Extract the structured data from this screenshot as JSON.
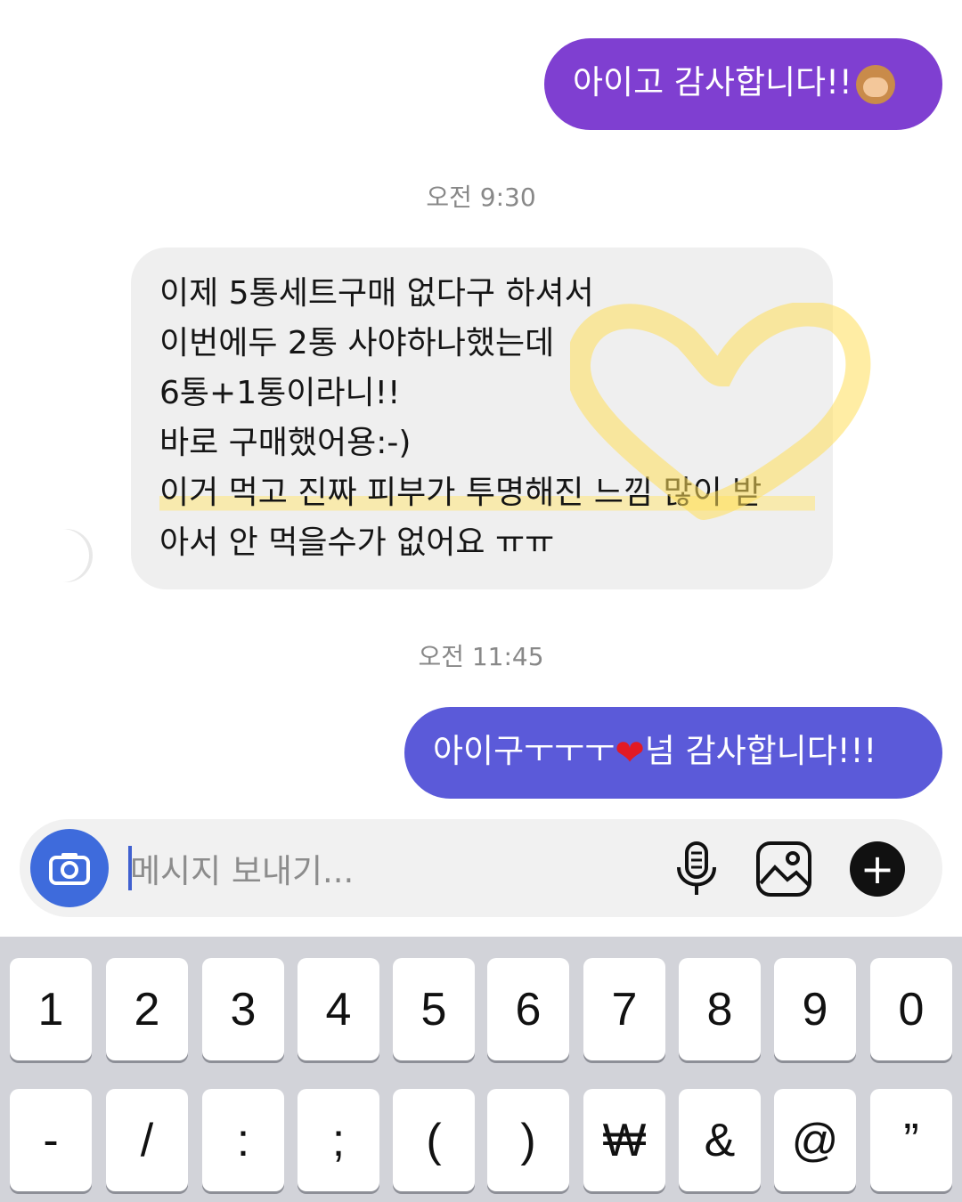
{
  "messages": [
    {
      "direction": "outgoing",
      "text": "아이고 감사합니다!!",
      "emoji": "see-no-evil-monkey"
    },
    {
      "type": "timestamp",
      "text": "오전 9:30"
    },
    {
      "direction": "incoming",
      "lines": [
        "이제 5통세트구매 없다구 하셔서",
        "이번에두 2통 사야하나했는데",
        "6통+1통이라니!!",
        "바로 구매했어용:-)",
        "이거 먹고 진짜 피부가 투명해진 느낌 많이 받",
        "아서 안 먹을수가 없어요 ㅠㅠ"
      ]
    },
    {
      "type": "timestamp",
      "text": "오전 11:45"
    },
    {
      "direction": "outgoing",
      "text_before": "아이구ㅜㅜㅜ",
      "emoji": "red-heart",
      "text_after": "넘 감사합니다!!!"
    }
  ],
  "composer": {
    "placeholder": "메시지 보내기..."
  },
  "keyboard": {
    "row1": [
      "1",
      "2",
      "3",
      "4",
      "5",
      "6",
      "7",
      "8",
      "9",
      "0"
    ],
    "row2": [
      "-",
      "/",
      ":",
      ";",
      "(",
      ")",
      "₩",
      "&",
      "@",
      "”"
    ]
  },
  "colors": {
    "outgoing_1": "#7f3fd1",
    "outgoing_2": "#5b5ad9",
    "incoming": "#efefef",
    "camera_button": "#3e6bdc",
    "highlight": "#ffe678"
  }
}
